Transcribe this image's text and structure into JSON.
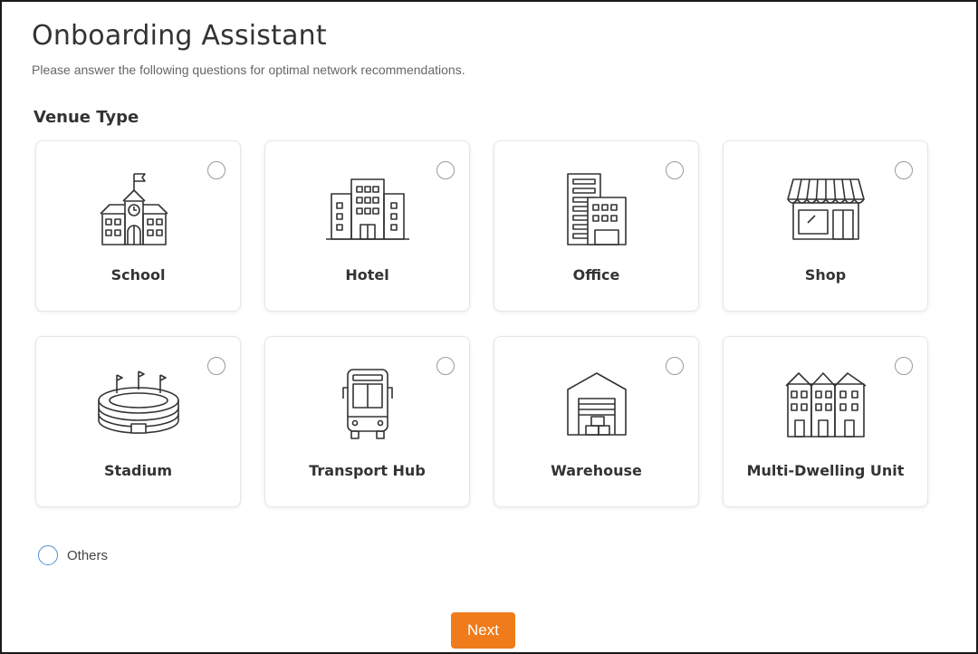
{
  "header": {
    "title": "Onboarding Assistant",
    "subtitle": "Please answer the following questions for optimal network recommendations."
  },
  "venue": {
    "section_title": "Venue Type",
    "options": [
      {
        "label": "School",
        "icon": "school-icon",
        "selected": false
      },
      {
        "label": "Hotel",
        "icon": "hotel-icon",
        "selected": false
      },
      {
        "label": "Office",
        "icon": "office-icon",
        "selected": false
      },
      {
        "label": "Shop",
        "icon": "shop-icon",
        "selected": false
      },
      {
        "label": "Stadium",
        "icon": "stadium-icon",
        "selected": false
      },
      {
        "label": "Transport Hub",
        "icon": "bus-icon",
        "selected": false
      },
      {
        "label": "Warehouse",
        "icon": "warehouse-icon",
        "selected": false
      },
      {
        "label": "Multi-Dwelling Unit",
        "icon": "apartment-icon",
        "selected": false
      }
    ],
    "others_label": "Others"
  },
  "actions": {
    "next_label": "Next"
  },
  "colors": {
    "accent": "#f07b1a",
    "radio_focus": "#4a8fd6",
    "text": "#333333",
    "muted": "#666666"
  }
}
